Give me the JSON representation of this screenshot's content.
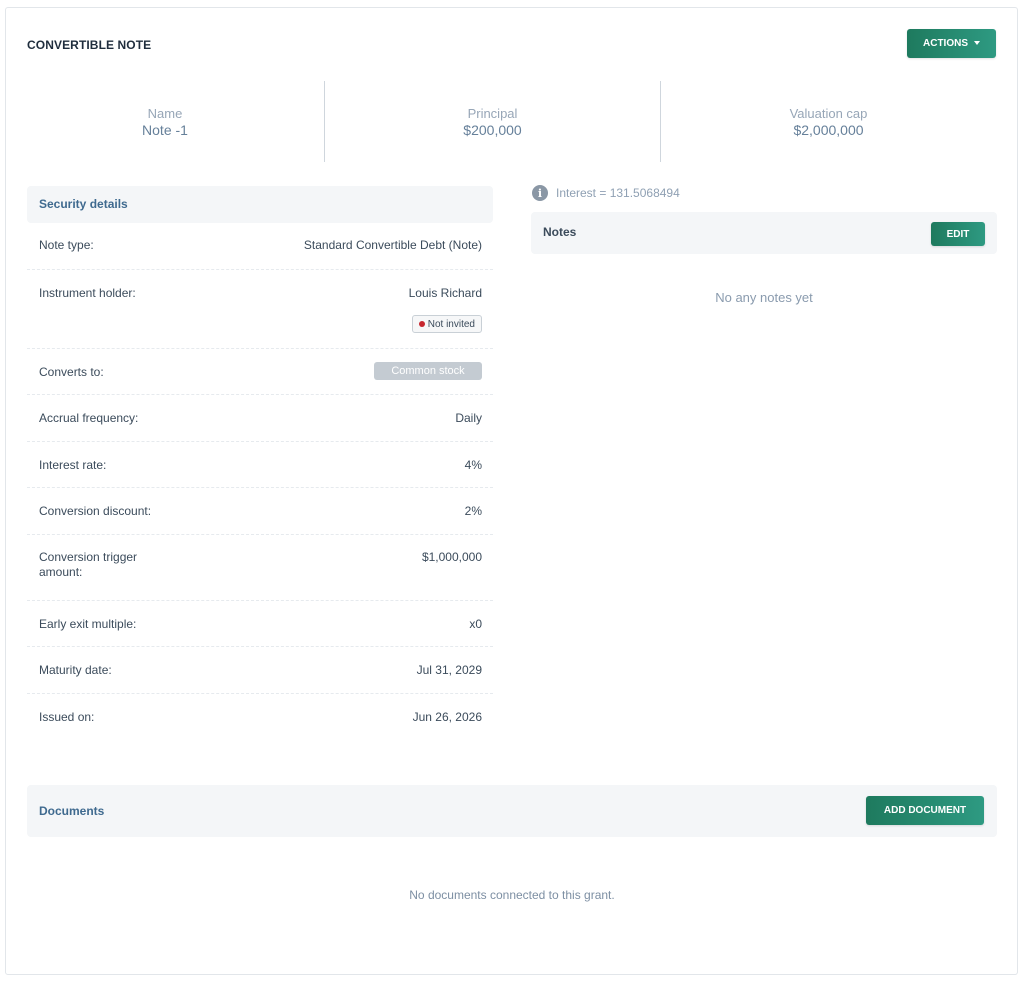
{
  "header": {
    "title": "CONVERTIBLE NOTE",
    "actions_label": "ACTIONS"
  },
  "summary": [
    {
      "label": "Name",
      "value": "Note -1"
    },
    {
      "label": "Principal",
      "value": "$200,000"
    },
    {
      "label": "Valuation cap",
      "value": "$2,000,000"
    }
  ],
  "security": {
    "title": "Security details",
    "rows": [
      {
        "key": "Note type:",
        "value": "Standard Convertible Debt (Note)"
      },
      {
        "key": "Instrument holder:",
        "value": "Louis Richard",
        "badge": "Not invited"
      },
      {
        "key": "Converts to:",
        "badge": "Common stock"
      },
      {
        "key": "Accrual frequency:",
        "value": "Daily"
      },
      {
        "key": "Interest rate:",
        "value": "4%"
      },
      {
        "key": "Conversion discount:",
        "value": "2%"
      },
      {
        "key": "Conversion trigger amount:",
        "value": "$1,000,000"
      },
      {
        "key": "Early exit multiple:",
        "value": "x0"
      },
      {
        "key": "Maturity date:",
        "value": "Jul 31, 2029"
      },
      {
        "key": "Issued on:",
        "value": "Jun 26, 2026"
      }
    ]
  },
  "interest": {
    "text": "Interest = 131.5068494",
    "icon": "info-icon"
  },
  "notes": {
    "title": "Notes",
    "edit_label": "EDIT",
    "empty": "No any notes yet"
  },
  "documents": {
    "title": "Documents",
    "add_label": "ADD DOCUMENT",
    "empty": "No documents connected to this grant."
  },
  "colors": {
    "accent": "#1e7a5e",
    "status_not_invited": "#c6262e",
    "section_title": "#3f6a8f"
  }
}
